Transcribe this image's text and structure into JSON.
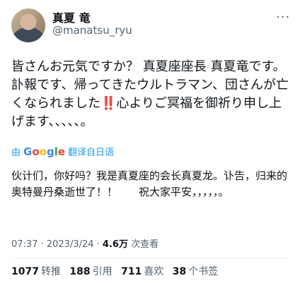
{
  "author": {
    "name": "真夏 竜",
    "handle": "@manatsu_ryu"
  },
  "tweet_ja": "皆さんお元気ですか？ 真夏座座長 真夏竜です。\n訃報です、帰ってきたウルトラマン、団さんが亡くなられました‼️心よりご冥福を御祈り申し上げます、、、、、。",
  "translate": {
    "prefix": "由",
    "g": [
      "G",
      "o",
      "o",
      "g",
      "l",
      "e"
    ],
    "action": "翻译自日语"
  },
  "tweet_zh": "伙计们，你好吗？我是真夏座的会长真夏龙。讣告，归来的奥特曼丹桑逝世了！！　　祝大家平安，，，，，。",
  "meta": {
    "time": "07:37 · 2023/3/24 · ",
    "views": "4.6万",
    "views_label": " 次查看"
  },
  "stats": {
    "retweets": "1077",
    "retweets_label": "转推",
    "quotes": "188",
    "quotes_label": "引用",
    "likes": "711",
    "likes_label": "喜欢",
    "bookmarks": "38",
    "bookmarks_label": "个书签"
  },
  "more_icon": "more-horizontal-icon"
}
